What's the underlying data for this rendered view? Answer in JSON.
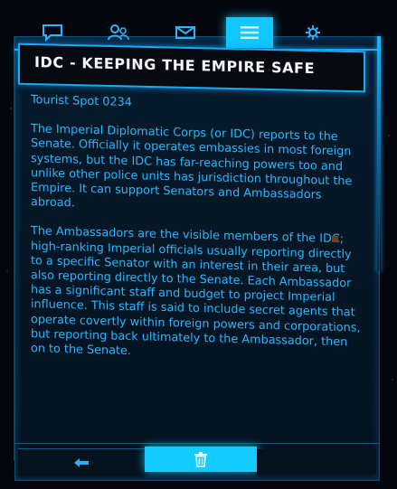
{
  "tabs": [
    {
      "name": "chat",
      "icon": "chat-bubble-icon"
    },
    {
      "name": "friends",
      "icon": "people-icon"
    },
    {
      "name": "inbox",
      "icon": "envelope-icon"
    },
    {
      "name": "codex",
      "icon": "list-icon",
      "active": true
    },
    {
      "name": "settings",
      "icon": "gear-icon"
    }
  ],
  "header": {
    "title": "IDC - KEEPING THE EMPIRE SAFE"
  },
  "message": {
    "source": "Tourist Spot 0234",
    "paragraph_1": "The Imperial Diplomatic Corps (or IDC) reports to the Senate. Officially it operates embassies in most foreign systems, but the IDC has far-reaching powers too and unlike other police units has jurisdiction throughout the Empire. It can support Senators and Ambassadors abroad.",
    "paragraph_2": "The Ambassadors are the visible members of the IDC; high-ranking Imperial officials usually reporting directly to a specific Senator with an interest in their area, but also reporting directly to the Senate. Each Ambassador has a significant staff and budget to project Imperial influence. This staff is said to include secret agents that operate covertly within foreign powers and corporations, but reporting back ultimately to the Ambassador, then on to the Senate."
  },
  "footer": {
    "back_icon": "back-arrow-icon",
    "delete_icon": "trash-icon"
  },
  "colors": {
    "accent": "#13cbff",
    "text": "#27b7ff",
    "title_text": "#f3f7fb",
    "background": "#051523"
  }
}
